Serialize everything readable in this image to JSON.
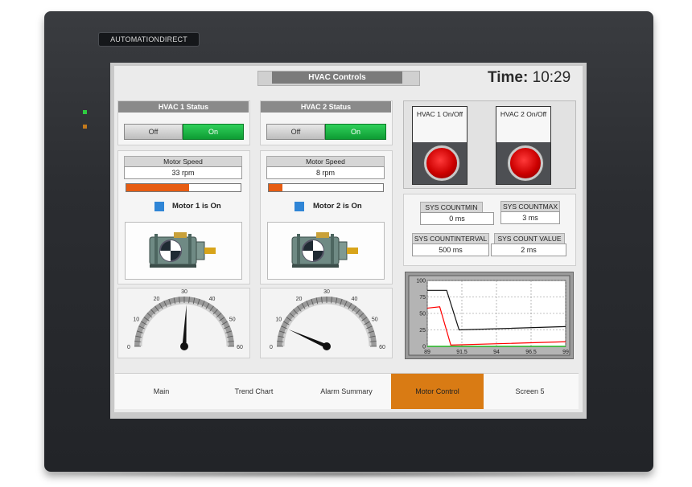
{
  "device": {
    "brand": "AUTOMATIONDIRECT"
  },
  "header": {
    "title": "HVAC Controls",
    "time_label": "Time:",
    "time_value": "10:29"
  },
  "hvac1": {
    "status_title": "HVAC 1 Status",
    "off_label": "Off",
    "on_label": "On",
    "speed_label": "Motor Speed",
    "speed_value": "33 rpm",
    "speed_fraction": 0.55,
    "indicator_text": "Motor 1 is On",
    "gauge": {
      "ticks": [
        "0",
        "10",
        "20",
        "30",
        "40",
        "50",
        "60"
      ],
      "needle_value": 31
    }
  },
  "hvac2": {
    "status_title": "HVAC 2 Status",
    "off_label": "Off",
    "on_label": "On",
    "speed_label": "Motor Speed",
    "speed_value": "8 rpm",
    "speed_fraction": 0.12,
    "indicator_text": "Motor 2 is On",
    "gauge": {
      "ticks": [
        "0",
        "10",
        "20",
        "30",
        "40",
        "50",
        "60"
      ],
      "needle_value": 8
    }
  },
  "pushbuttons": [
    {
      "label": "HVAC 1 On/Off"
    },
    {
      "label": "HVAC 2 On/Off"
    }
  ],
  "counters": {
    "min_label": "SYS COUNTMIN",
    "min_value": "0 ms",
    "max_label": "SYS COUNTMAX",
    "max_value": "3 ms",
    "interval_label": "SYS COUNTINTERVAL",
    "interval_value": "500 ms",
    "count_label": "SYS COUNT VALUE",
    "count_value": "2 ms"
  },
  "chart_data": {
    "type": "line",
    "x_ticks": [
      "89",
      "91.5",
      "94",
      "96.5",
      "99"
    ],
    "y_ticks": [
      "0",
      "25",
      "50",
      "75",
      "100"
    ],
    "xlim": [
      89,
      99
    ],
    "ylim": [
      0,
      100
    ],
    "grid": true,
    "series": [
      {
        "color": "#111111",
        "x": [
          89,
          90.4,
          91.3,
          99
        ],
        "y": [
          85,
          85,
          25,
          30
        ]
      },
      {
        "color": "#ff0000",
        "x": [
          89,
          89.9,
          90.7,
          99
        ],
        "y": [
          58,
          60,
          2,
          7
        ]
      },
      {
        "color": "#00b000",
        "x": [
          89,
          99
        ],
        "y": [
          0,
          0
        ]
      }
    ]
  },
  "nav": {
    "items": [
      "Main",
      "Trend Chart",
      "Alarm Summary",
      "Motor Control",
      "Screen 5"
    ],
    "active_index": 3
  },
  "colors": {
    "accent": "#d97b14",
    "on_green": "#19b844",
    "bar_fill": "#e65c12",
    "indicator": "#2f85d6"
  }
}
